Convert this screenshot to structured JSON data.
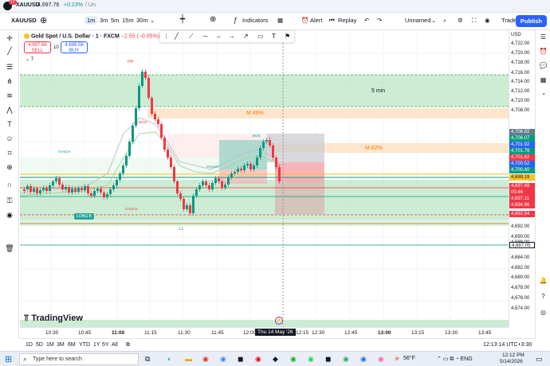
{
  "tab": {
    "symbol": "XAUUSD",
    "price": "4,697.76",
    "change": "+0.23%",
    "extra": "/ Un",
    "badge": "13"
  },
  "toolbar": {
    "timeframes": [
      "1m",
      "3m",
      "5m",
      "15m",
      "30m"
    ],
    "selected_tf": "1m",
    "indicators": "Indicators",
    "alert": "Alert",
    "replay": "Replay",
    "layout": "Unnamed",
    "trade": "Trade",
    "publish": "Publish"
  },
  "legend": {
    "title": "Gold Spot / U.S. Dollar · 1 · FXCM",
    "change": "−2.55 (−0.05%)",
    "layers": "7"
  },
  "order": {
    "sell_price": "4,697.66",
    "sell_label": "SELL",
    "spread": "10",
    "buy_price": "4,698.56",
    "buy_label": "BUY"
  },
  "zones": {
    "m5": "5 min",
    "m49": "M 49%",
    "m62": "M 62%"
  },
  "annotations": {
    "hh": "HH",
    "ll": "LL",
    "long": "LONG B",
    "choch1": "CHoCH",
    "choch2": "CHoCH",
    "choch3": "CHoCH",
    "bos": "BOS",
    "ibos": "i-BOS"
  },
  "price_axis": {
    "currency": "USD",
    "labels": [
      "4,722.00",
      "4,720.00",
      "4,718.00",
      "4,716.00",
      "4,714.00",
      "4,712.00",
      "4,710.00",
      "4,708.00",
      "4,694.00",
      "4,692.00",
      "4,690.00",
      "4,688.00",
      "4,684.00",
      "4,682.00",
      "4,680.00",
      "4,678.00",
      "4,676.00",
      "4,674.00"
    ],
    "tags": [
      {
        "text": "4,706.92",
        "color": "#607d8b"
      },
      {
        "text": "4,706.07",
        "color": "#089981"
      },
      {
        "text": "4,701.92",
        "color": "#2962ff"
      },
      {
        "text": "4,701.76",
        "color": "#089981"
      },
      {
        "text": "4,701.62",
        "color": "#f23645"
      },
      {
        "text": "4,700.52",
        "color": "#2962ff"
      },
      {
        "text": "4,700.40",
        "color": "#089981"
      },
      {
        "text": "4,699.19",
        "color": "#f7c52a"
      },
      {
        "text": "4,697.49",
        "color": "#f23645"
      },
      {
        "text": "00:46",
        "color": "#f23645"
      },
      {
        "text": "4,697.11",
        "color": "#f23645"
      },
      {
        "text": "4,694.96",
        "color": "#f23645"
      },
      {
        "text": "4,692.54",
        "color": "#f23645"
      },
      {
        "text": "4,687.05",
        "color": "#131722"
      }
    ]
  },
  "time_axis": {
    "labels": [
      "10:30",
      "10:45",
      "11:00",
      "11:15",
      "11:30",
      "11:45",
      "12:00",
      "12:30",
      "12:45",
      "13:00",
      "13:15",
      "13:30",
      "13:45"
    ],
    "cursor": "Thu 14 May '26",
    "cursor2": "12:15"
  },
  "bottom": {
    "ranges": [
      "1D",
      "5D",
      "1M",
      "3M",
      "6M",
      "YTD",
      "1Y",
      "5Y",
      "All"
    ],
    "clock": "12:13:14 UTC+3:30"
  },
  "taskbar": {
    "search": "Type here to search",
    "weather": "56°F",
    "time": "12:12 PM",
    "date": "5/14/2026"
  },
  "brand": "TradingView"
}
